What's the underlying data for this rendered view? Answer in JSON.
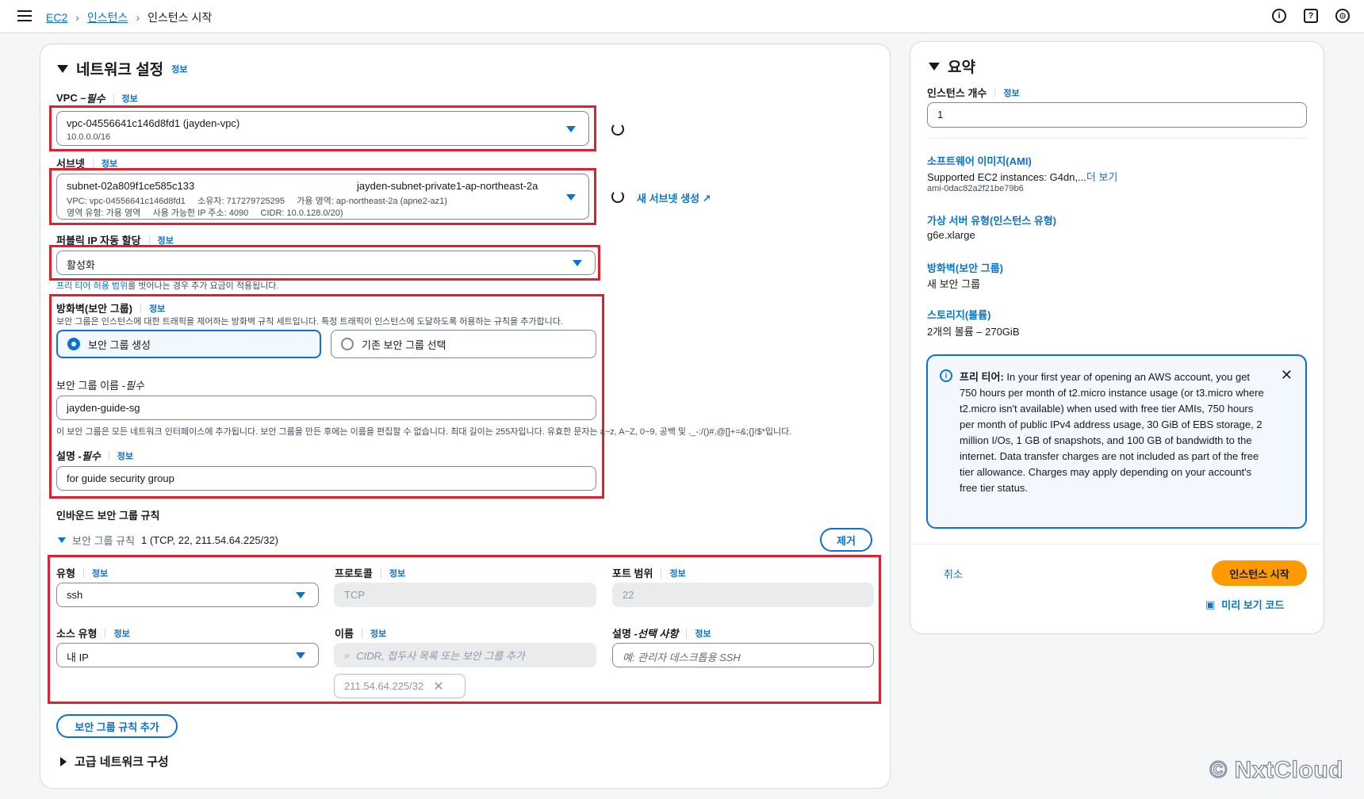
{
  "breadcrumb": {
    "items": [
      "EC2",
      "인스턴스"
    ],
    "current": "인스턴스 시작"
  },
  "network": {
    "title": "네트워크 설정",
    "info": "정보",
    "vpc_label": "VPC – ",
    "vpc_required": "필수",
    "vpc_value": "vpc-04556641c146d8fd1 (jayden-vpc)",
    "vpc_cidr": "10.0.0.0/16",
    "subnet_label": "서브넷",
    "subnet_id": "subnet-02a809f1ce585c133",
    "subnet_name": "jayden-subnet-private1-ap-northeast-2a",
    "subnet_line2": "VPC: vpc-04556641c146d8fd1     소유자: 717279725295     가용 영역: ap-northeast-2a (apne2-az1)",
    "subnet_line3": "영역 유형: 가용 영역     사용 가능한 IP 주소: 4090     CIDR: 10.0.128.0/20)",
    "new_subnet": "새 서브넷 생성",
    "public_ip_label": "퍼블릭 IP 자동 할당",
    "public_ip_value": "활성화",
    "free_tier_note_link": "프리 티어 허용 범위",
    "free_tier_note_rest": "를 벗어나는 경우 추가 요금이 적용됩니다.",
    "fw_label": "방화벽(보안 그룹)",
    "fw_desc": "보안 그룹은 인스턴스에 대한 트래픽을 제어하는 방화벽 규칙 세트입니다. 특정 트래픽이 인스턴스에 도달하도록 허용하는 규칙을 추가합니다.",
    "fw_option_create": "보안 그룹 생성",
    "fw_option_existing": "기존 보안 그룹 선택",
    "sg_name_label": "보안 그룹 이름 - ",
    "sg_name_required": "필수",
    "sg_name_value": "jayden-guide-sg",
    "sg_name_hint": "이 보안 그룹은 모든 네트워크 인터페이스에 추가됩니다. 보안 그룹을 만든 후에는 이름을 편집할 수 없습니다. 최대 길이는 255자입니다. 유효한 문자는 a~z, A~Z, 0~9, 공백 및 ._-:/()#,@[]+=&;{}!$*입니다.",
    "desc_label": "설명 - ",
    "desc_required": "필수",
    "desc_value": "for guide security group",
    "inbound_title": "인바운드 보안 그룹 규칙",
    "rule_prefix": "보안 그룹 규칙",
    "rule_summary": "1 (TCP, 22, 211.54.64.225/32)",
    "remove_button": "제거",
    "type_label": "유형",
    "type_value": "ssh",
    "protocol_label": "프로토콜",
    "protocol_value": "TCP",
    "port_label": "포트 범위",
    "port_value": "22",
    "source_type_label": "소스 유형",
    "source_type_value": "내 IP",
    "name_label": "이름",
    "name_placeholder": "CIDR, 접두사 목록 또는 보안 그룹 추가",
    "rule_desc_label": "설명 - ",
    "rule_desc_optional": "선택 사항",
    "rule_desc_placeholder": "예: 관리자 데스크톱용 SSH",
    "ip_token": "211.54.64.225/32",
    "add_rule_button": "보안 그룹 규칙 추가",
    "advanced": "고급 네트워크 구성"
  },
  "summary": {
    "title": "요약",
    "count_label": "인스턴스 개수",
    "count_value": "1",
    "ami_title": "소프트웨어 이미지(AMI)",
    "ami_desc": "Supported EC2 instances: G4dn,...",
    "ami_more": "더 보기",
    "ami_id": "ami-0dac82a2f21be79b6",
    "type_title": "가상 서버 유형(인스턴스 유형)",
    "type_value": "g6e.xlarge",
    "fw_title": "방화벽(보안 그룹)",
    "fw_value": "새 보안 그룹",
    "storage_title": "스토리지(볼륨)",
    "storage_value": "2개의 볼륨 – 270GiB",
    "free_tier_bold": "프리 티어:",
    "free_tier_text": " In your first year of opening an AWS account, you get 750 hours per month of t2.micro instance usage (or t3.micro where t2.micro isn't available) when used with free tier AMIs, 750 hours per month of public IPv4 address usage, 30 GiB of EBS storage, 2 million I/Os, 1 GB of snapshots, and 100 GB of bandwidth to the internet. Data transfer charges are not included as part of the free tier allowance. Charges may apply depending on your account's free tier status.",
    "cancel": "취소",
    "launch": "인스턴스 시작",
    "preview_code": "미리 보기 코드"
  },
  "watermark": "© NxtCloud"
}
